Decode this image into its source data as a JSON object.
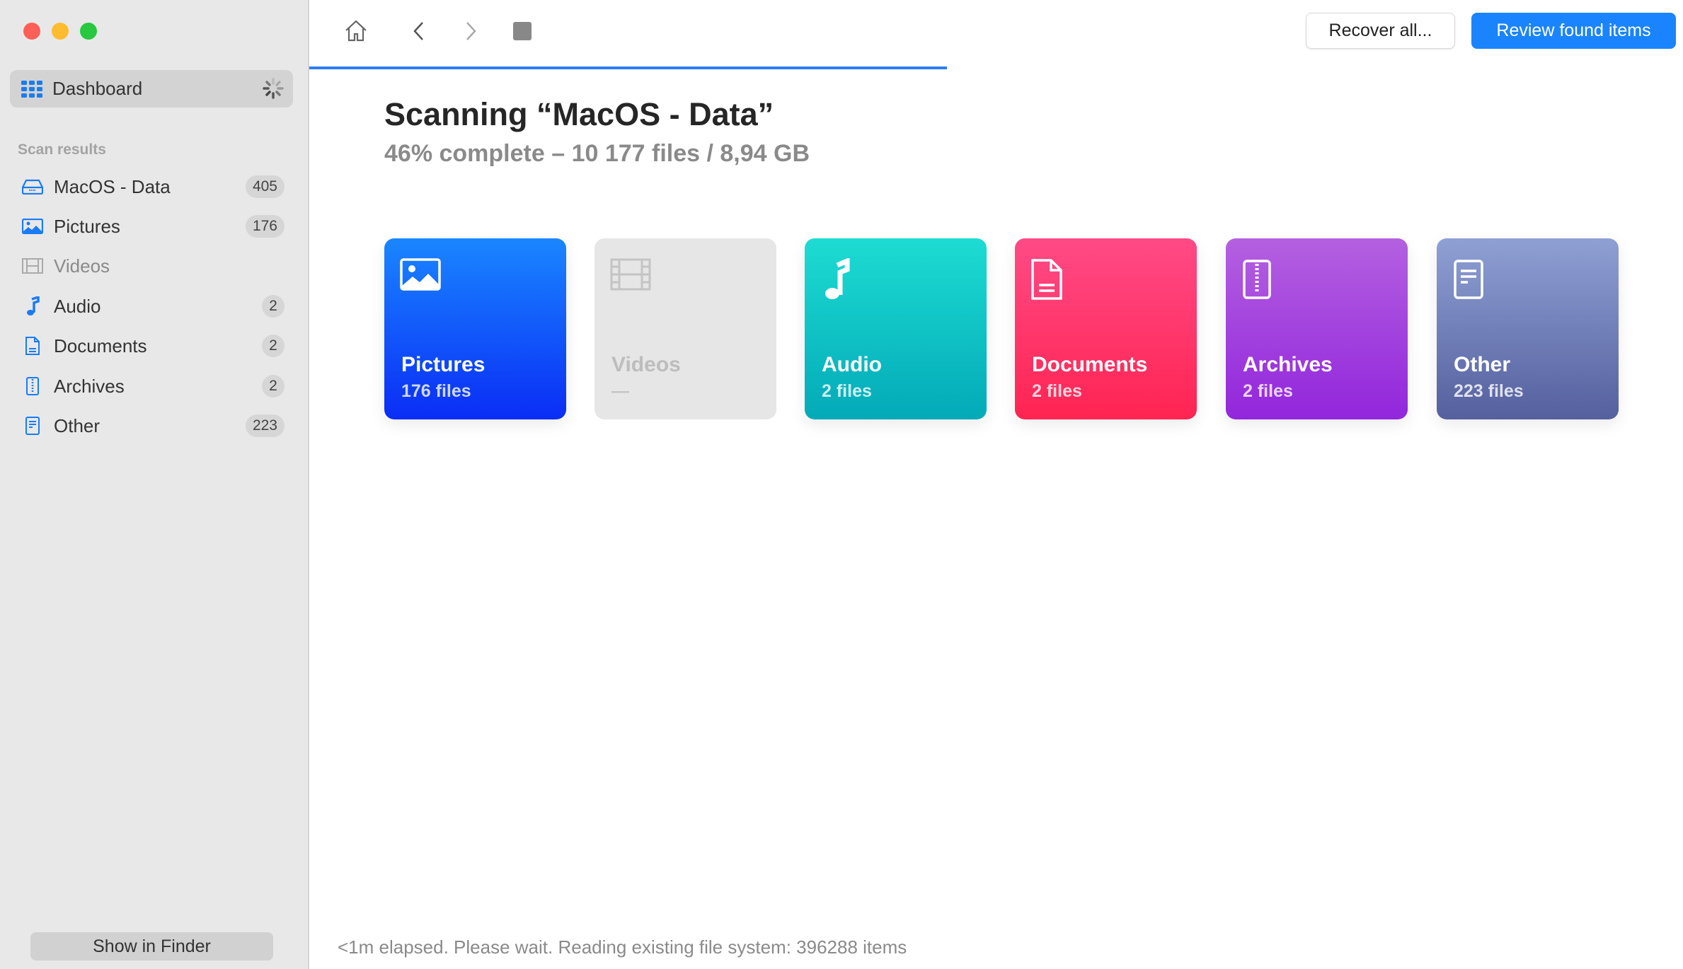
{
  "sidebar": {
    "dashboard_label": "Dashboard",
    "section_label": "Scan results",
    "items": [
      {
        "label": "MacOS - Data",
        "count": "405",
        "icon": "drive-icon"
      },
      {
        "label": "Pictures",
        "count": "176",
        "icon": "picture-icon"
      },
      {
        "label": "Videos",
        "count": "",
        "icon": "film-icon"
      },
      {
        "label": "Audio",
        "count": "2",
        "icon": "music-note-icon"
      },
      {
        "label": "Documents",
        "count": "2",
        "icon": "document-icon"
      },
      {
        "label": "Archives",
        "count": "2",
        "icon": "archive-icon"
      },
      {
        "label": "Other",
        "count": "223",
        "icon": "other-file-icon"
      }
    ],
    "show_in_finder": "Show in Finder"
  },
  "toolbar": {
    "recover_all": "Recover all...",
    "review_found": "Review found items",
    "progress_percent": 46
  },
  "main": {
    "title": "Scanning “MacOS - Data”",
    "subtitle": "46% complete – 10 177 files / 8,94 GB",
    "cards": [
      {
        "label": "Pictures",
        "sub": "176 files",
        "colors": [
          "#1a86ff",
          "#0a2df5"
        ]
      },
      {
        "label": "Videos",
        "sub": "—",
        "colors": [
          "#e6e6e6",
          "#e6e6e6"
        ]
      },
      {
        "label": "Audio",
        "sub": "2 files",
        "colors": [
          "#1ddcd2",
          "#03aab8"
        ]
      },
      {
        "label": "Documents",
        "sub": "2 files",
        "colors": [
          "#ff4a86",
          "#ff2452"
        ]
      },
      {
        "label": "Archives",
        "sub": "2 files",
        "colors": [
          "#b460e0",
          "#9226dc"
        ]
      },
      {
        "label": "Other",
        "sub": "223 files",
        "colors": [
          "#8fa0d4",
          "#55609e"
        ]
      }
    ],
    "status": "<1m elapsed. Please wait. Reading existing file system: 396288 items"
  },
  "colors": {
    "accent": "#1a84ff",
    "close": "#fe5f57",
    "minimize": "#febc2e",
    "zoom": "#28c840"
  }
}
